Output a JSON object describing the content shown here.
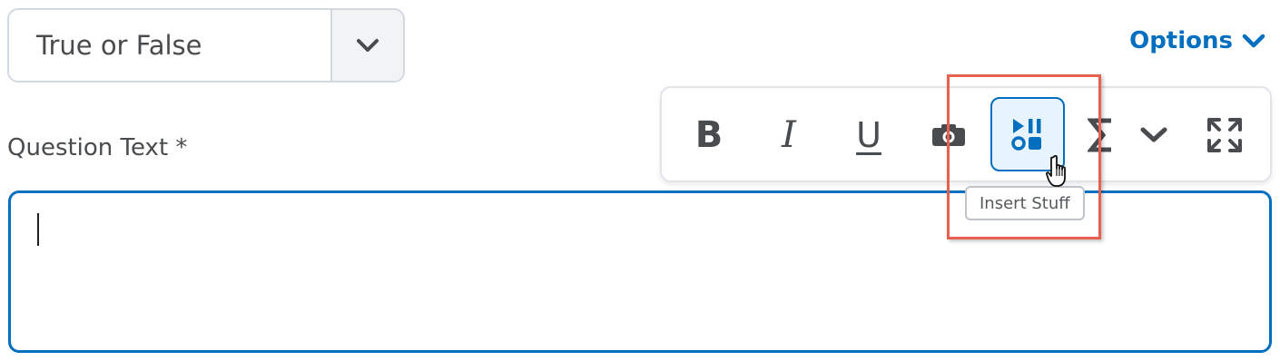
{
  "question_type": {
    "selected": "True or False",
    "icon": "chevron-down-icon"
  },
  "options": {
    "label": "Options",
    "icon": "chevron-down-icon",
    "color": "#006fbf"
  },
  "question_text": {
    "label": "Question Text *",
    "value": ""
  },
  "toolbar": {
    "bold": "B",
    "italic": "I",
    "underline": "U",
    "items": [
      "bold-icon",
      "italic-icon",
      "underline-icon",
      "camera-icon",
      "insert-stuff-icon",
      "sigma-icon",
      "chevron-down-icon",
      "fullscreen-icon"
    ],
    "active_item": "insert-stuff-icon",
    "tooltip": "Insert Stuff"
  },
  "colors": {
    "accent": "#006fbf",
    "highlight": "#e8604f",
    "text": "#494c4e",
    "border": "#d3d9e3"
  }
}
